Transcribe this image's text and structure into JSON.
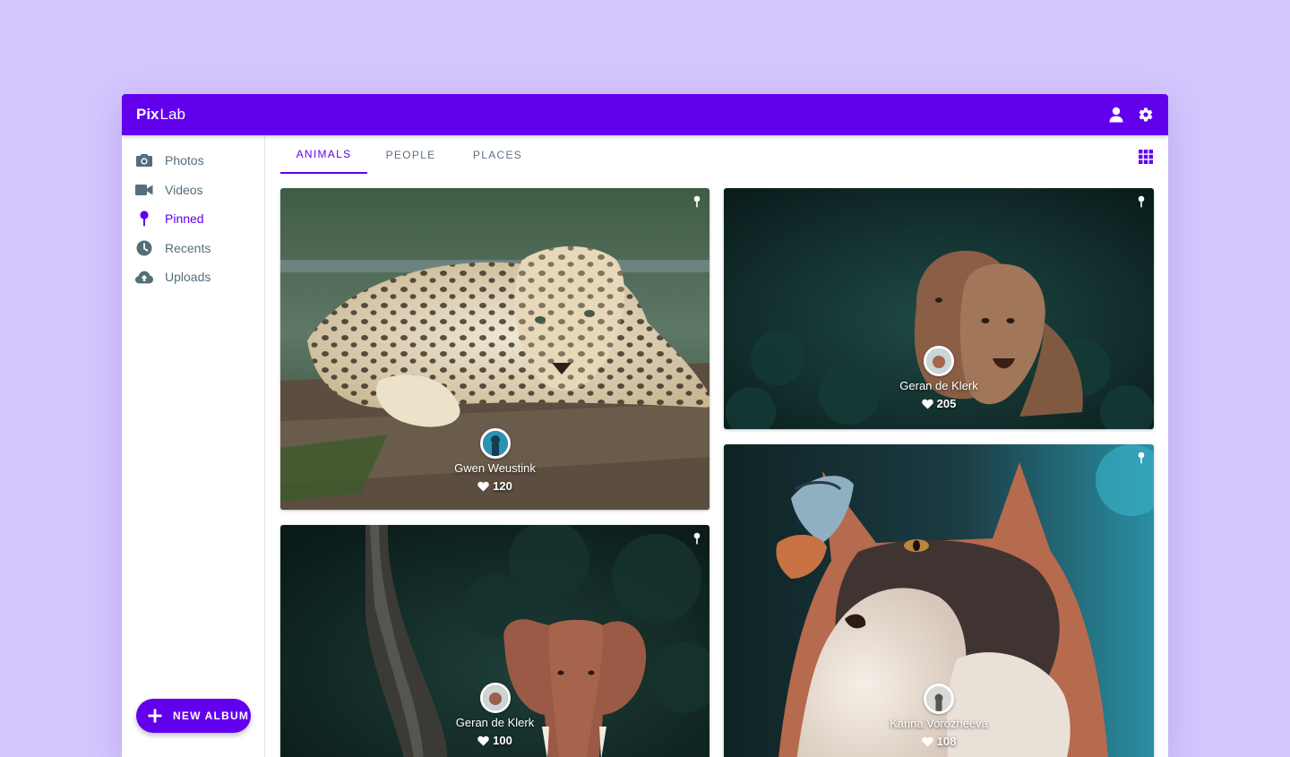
{
  "app": {
    "brand_bold": "Pix",
    "brand_light": "Lab",
    "accent": "#6200ee",
    "background": "#d4c6fd"
  },
  "topbar": {
    "icons": [
      "account-icon",
      "settings-icon"
    ]
  },
  "sidebar": {
    "items": [
      {
        "label": "Photos",
        "icon": "camera-icon",
        "active": false
      },
      {
        "label": "Videos",
        "icon": "videocam-icon",
        "active": false
      },
      {
        "label": "Pinned",
        "icon": "pin-icon",
        "active": true
      },
      {
        "label": "Recents",
        "icon": "clock-icon",
        "active": false
      },
      {
        "label": "Uploads",
        "icon": "cloud-upload-icon",
        "active": false
      }
    ],
    "fab_label": "NEW ALBUM",
    "fab_icon": "plus-icon"
  },
  "tabs": [
    {
      "label": "ANIMALS",
      "active": true
    },
    {
      "label": "PEOPLE",
      "active": false
    },
    {
      "label": "PLACES",
      "active": false
    }
  ],
  "view_toggle_icon": "grid-view-icon",
  "cards": [
    {
      "subject": "leopard",
      "author": "Gwen Weustink",
      "likes": "120",
      "pinned": true
    },
    {
      "subject": "lionesses",
      "author": "Geran de Klerk",
      "likes": "205",
      "pinned": true
    },
    {
      "subject": "elephant",
      "author": "Geran de Klerk",
      "likes": "100",
      "pinned": true
    },
    {
      "subject": "cat-with-butterfly",
      "author": "Karina Vorozheeva",
      "likes": "108",
      "pinned": true
    }
  ]
}
